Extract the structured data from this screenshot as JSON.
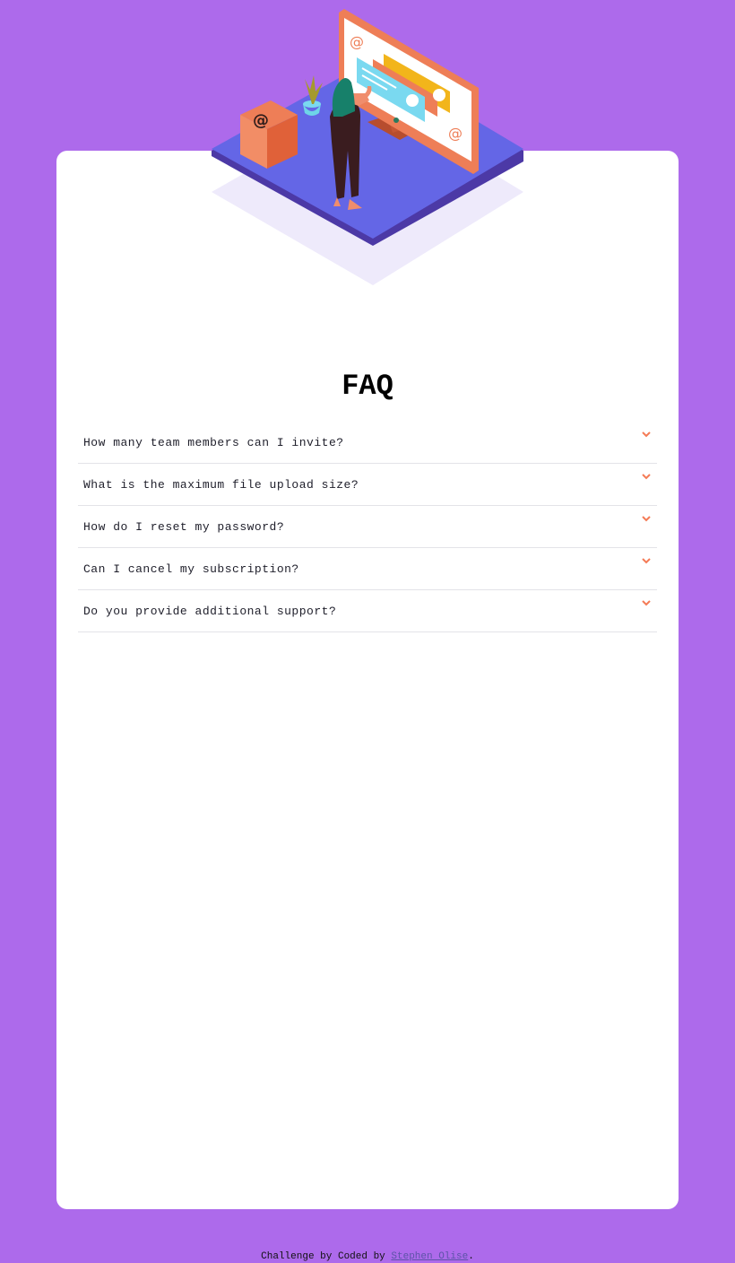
{
  "colors": {
    "background": "#ad6aeb",
    "card": "#ffffff",
    "accent": "#f47b56",
    "divider": "#e3e3e8"
  },
  "illustration": {
    "name": "woman-at-online-screen-illustration"
  },
  "faq": {
    "title": "FAQ",
    "items": [
      {
        "question": "How many team members can I invite?",
        "icon": "chevron-down-icon"
      },
      {
        "question": "What is the maximum file upload size?",
        "icon": "chevron-down-icon"
      },
      {
        "question": "How do I reset my password?",
        "icon": "chevron-down-icon"
      },
      {
        "question": "Can I cancel my subscription?",
        "icon": "chevron-down-icon"
      },
      {
        "question": "Do you provide additional support?",
        "icon": "chevron-down-icon"
      }
    ]
  },
  "footer": {
    "prefix": "Challenge by Coded by",
    "author_link": "Stephen Olise",
    "suffix": "."
  }
}
